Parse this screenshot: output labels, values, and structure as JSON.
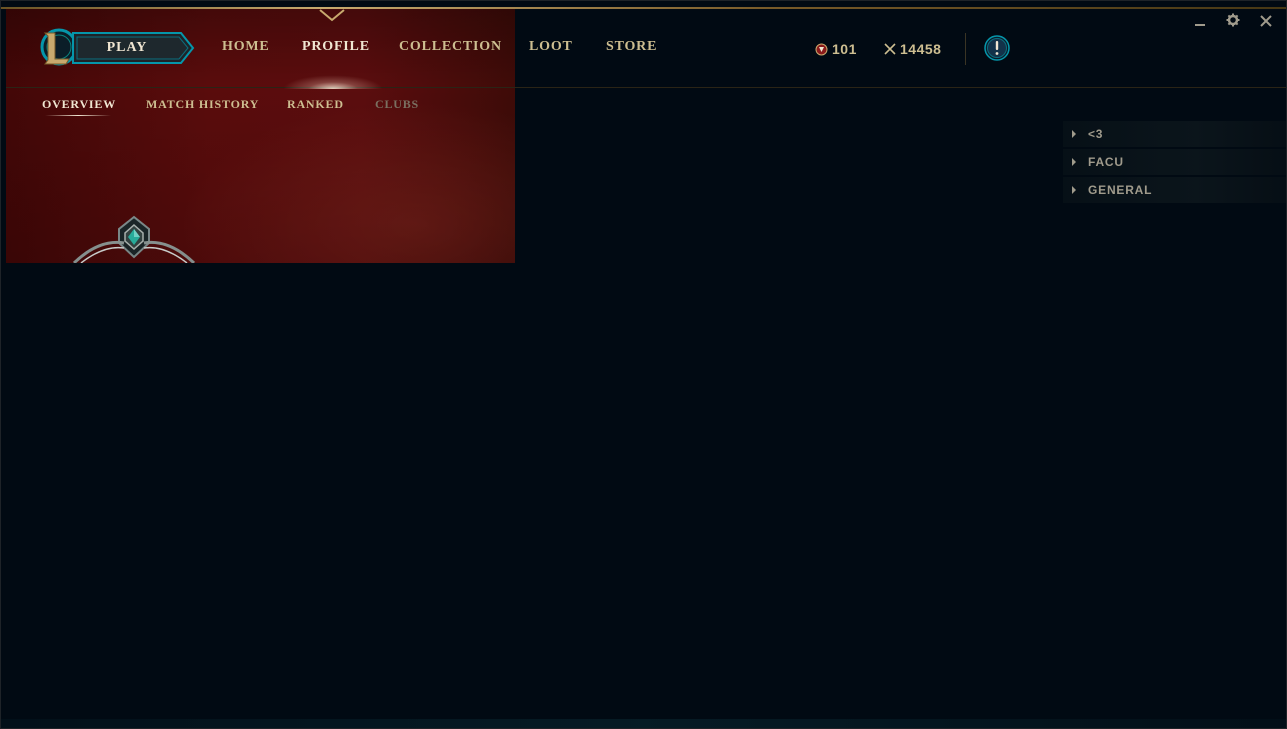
{
  "header": {
    "play_label": "PLAY",
    "nav": [
      {
        "label": "HOME",
        "active": false
      },
      {
        "label": "PROFILE",
        "active": true
      },
      {
        "label": "COLLECTION",
        "active": false
      },
      {
        "label": "LOOT",
        "active": false
      },
      {
        "label": "STORE",
        "active": false
      }
    ],
    "currencies": {
      "rp": {
        "value": "101",
        "icon": "rp-coin-icon"
      },
      "be": {
        "value": "14458",
        "icon": "blue-essence-icon"
      }
    },
    "alert_icon": "exclamation-alert-icon"
  },
  "window_controls": {
    "minimize": "minimize-icon",
    "settings": "gear-icon",
    "close": "close-icon"
  },
  "profile": {
    "subnav": [
      {
        "label": "OVERVIEW",
        "state": "active"
      },
      {
        "label": "MATCH HISTORY",
        "state": "normal"
      },
      {
        "label": "RANKED",
        "state": "normal"
      },
      {
        "label": "CLUBS",
        "state": "disabled"
      }
    ]
  },
  "social": {
    "groups": [
      {
        "label": "<3"
      },
      {
        "label": "FACU"
      },
      {
        "label": "GENERAL"
      }
    ]
  },
  "colors": {
    "gold": "#c8aa6e",
    "text_gold": "#cdbe91",
    "text_light": "#f0e6d2",
    "banner_red": "#5a0c0c",
    "background": "#010a13",
    "accent_blue": "#0ac8b9"
  }
}
